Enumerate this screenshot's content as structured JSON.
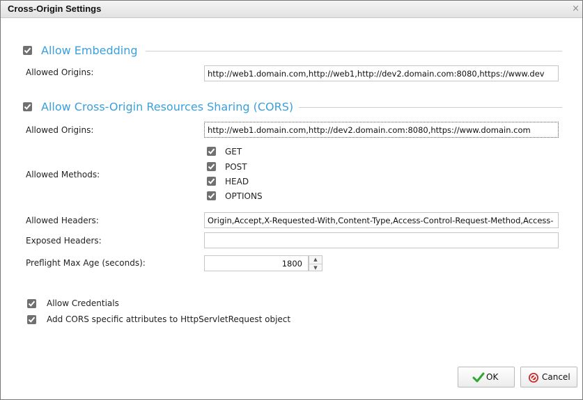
{
  "dialog": {
    "title": "Cross-Origin Settings",
    "close_glyph": "×"
  },
  "embedding": {
    "checkbox_checked": true,
    "title": "Allow Embedding",
    "allowed_origins_label": "Allowed Origins:",
    "allowed_origins_value": "http://web1.domain.com,http://web1,http://dev2.domain.com:8080,https://www.dev"
  },
  "cors": {
    "checkbox_checked": true,
    "title": "Allow Cross-Origin Resources Sharing (CORS)",
    "allowed_origins_label": "Allowed Origins:",
    "allowed_origins_value": "http://web1.domain.com,http://dev2.domain.com:8080,https://www.domain.com",
    "allowed_methods_label": "Allowed Methods:",
    "methods": [
      {
        "label": "GET",
        "checked": true
      },
      {
        "label": "POST",
        "checked": true
      },
      {
        "label": "HEAD",
        "checked": true
      },
      {
        "label": "OPTIONS",
        "checked": true
      }
    ],
    "allowed_headers_label": "Allowed Headers:",
    "allowed_headers_value": "Origin,Accept,X-Requested-With,Content-Type,Access-Control-Request-Method,Access-",
    "exposed_headers_label": "Exposed Headers:",
    "exposed_headers_value": "",
    "preflight_label": "Preflight Max Age (seconds):",
    "preflight_value": "1800"
  },
  "options": {
    "allow_credentials_label": "Allow Credentials",
    "allow_credentials_checked": true,
    "add_attributes_label": "Add CORS specific attributes to HttpServletRequest object",
    "add_attributes_checked": true
  },
  "buttons": {
    "ok_label": "OK",
    "cancel_label": "Cancel"
  },
  "colors": {
    "section_title": "#3aa0dd",
    "checkbox_fill": "#707070",
    "ok_check": "#2fa82f",
    "cancel_icon": "#cc2a2a"
  },
  "icons": {
    "checkbox": "check-mark",
    "ok": "green-checkmark-icon",
    "cancel": "red-cancel-icon",
    "close": "close-icon",
    "stepper": "up-down-arrows"
  }
}
